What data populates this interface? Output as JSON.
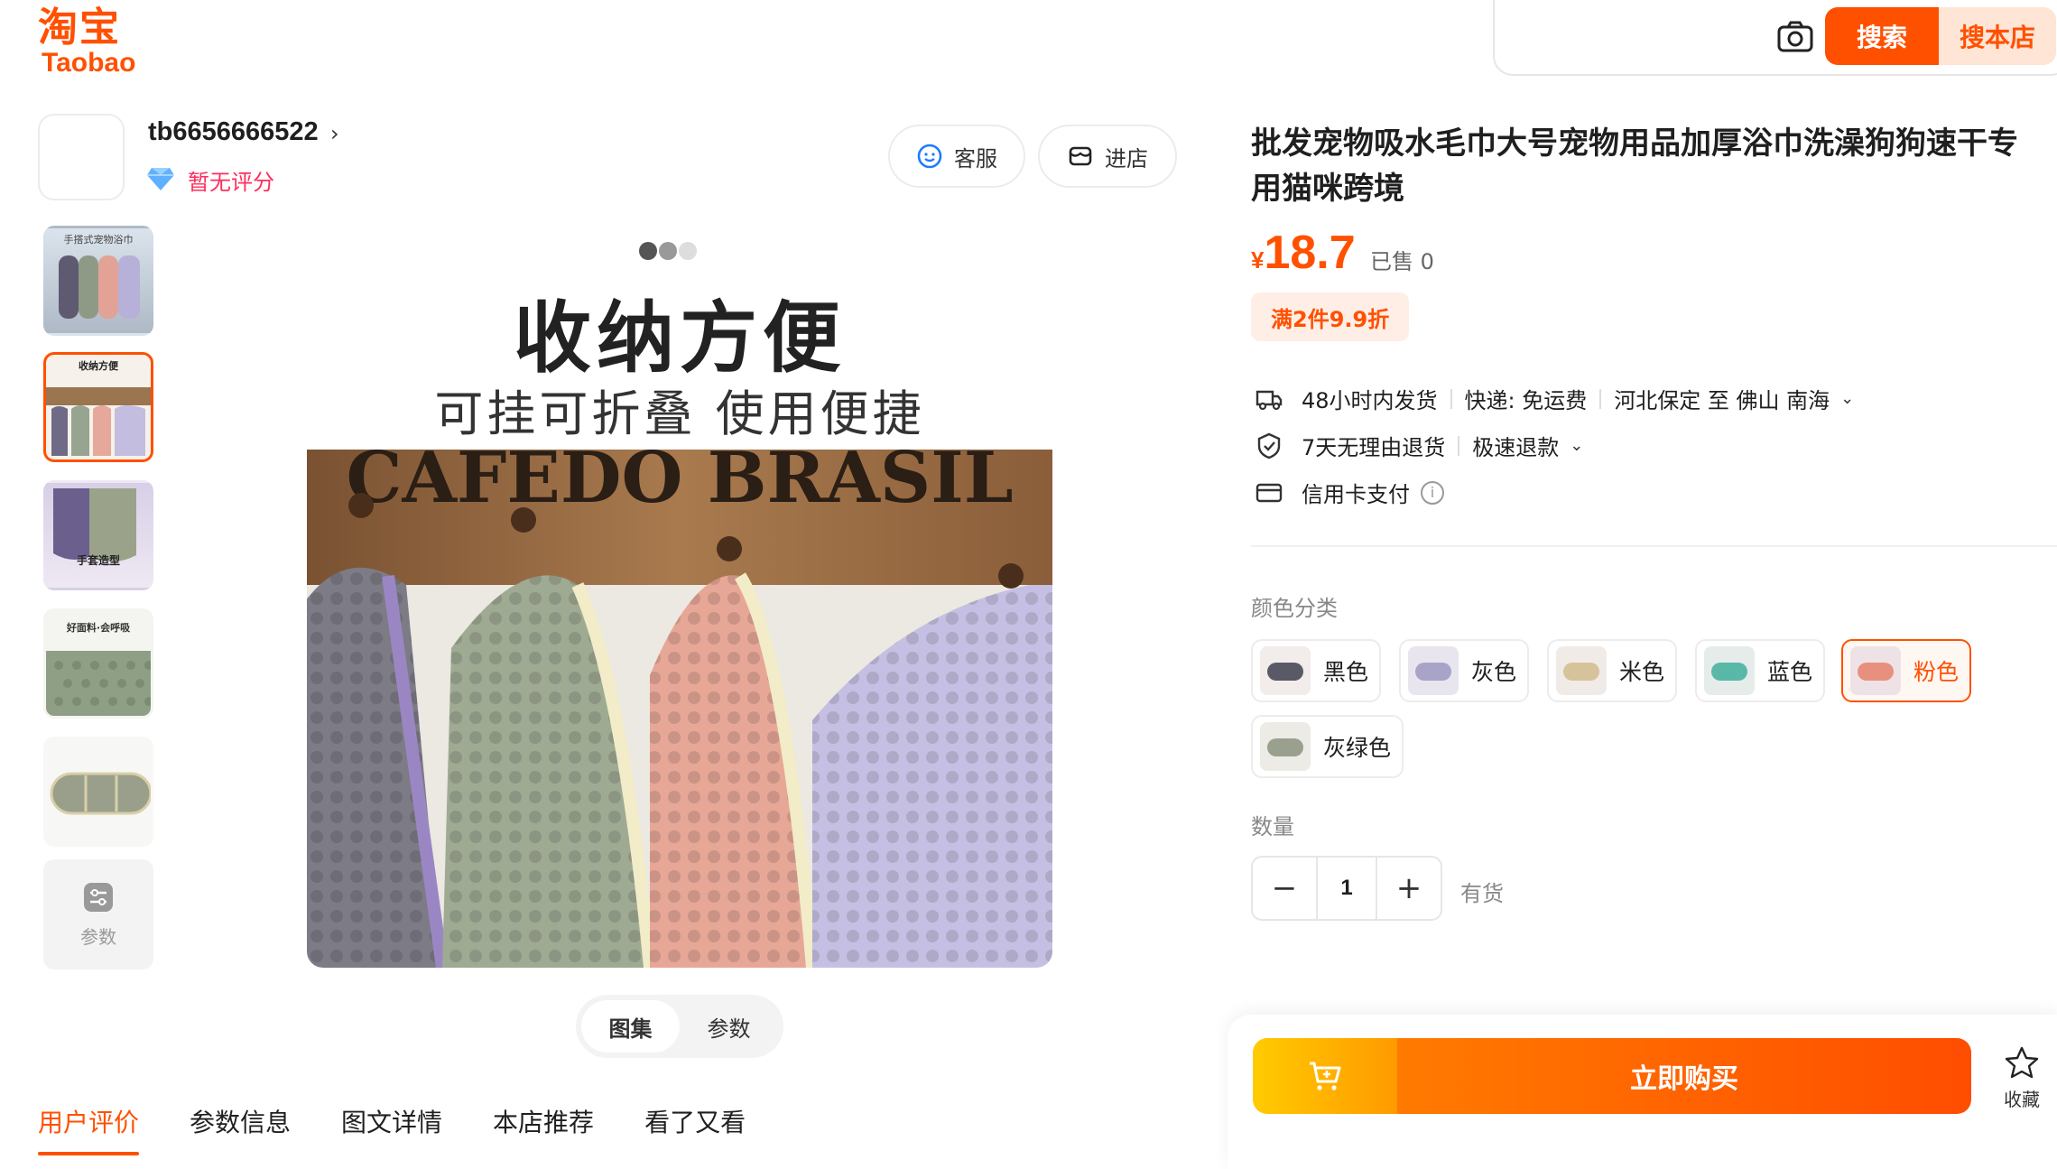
{
  "header": {
    "logo_cn": "淘宝",
    "logo_en": "Taobao",
    "search_placeholder": "",
    "search_button": "搜索",
    "shop_search_button": "搜本店"
  },
  "shop": {
    "name": "tb6656666522",
    "rating": "暂无评分",
    "service_button": "客服",
    "enter_shop_button": "进店"
  },
  "gallery": {
    "thumbnails": [
      {
        "caption": "手搭式宠物浴巾",
        "caption2": ""
      },
      {
        "caption": "收纳方便",
        "caption2": "CAFEDO BRASIL"
      },
      {
        "caption": "",
        "caption2": "手套造型"
      },
      {
        "caption": "好面料·会呼吸",
        "caption2": ""
      },
      {
        "caption": "",
        "caption2": ""
      }
    ],
    "params_thumb_label": "参数",
    "main_title": "收纳方便",
    "main_subtitle": "可挂可折叠 使用便捷",
    "sign_text": "CAFEDO BRASIL",
    "toggle": [
      "图集",
      "参数"
    ]
  },
  "tabs": [
    "用户评价",
    "参数信息",
    "图文详情",
    "本店推荐",
    "看了又看"
  ],
  "product": {
    "title": "批发宠物吸水毛巾大号宠物用品加厚浴巾洗澡狗狗速干专用猫咪跨境",
    "currency": "¥",
    "price": "18.7",
    "sold": "已售 0",
    "promo": "满2件9.9折",
    "shipping_time": "48小时内发货",
    "shipping_fee": "快递: 免运费",
    "route": "河北保定 至 佛山 南海",
    "returns": "7天无理由退货",
    "refund": "极速退款",
    "payment": "信用卡支付"
  },
  "sku": {
    "label": "颜色分类",
    "options": [
      {
        "label": "黑色",
        "color": "#5a5a66"
      },
      {
        "label": "灰色",
        "color": "#a8a4c8"
      },
      {
        "label": "米色",
        "color": "#d6c39a"
      },
      {
        "label": "蓝色",
        "color": "#5ab8a8"
      },
      {
        "label": "粉色",
        "color": "#e8907e"
      },
      {
        "label": "灰绿色",
        "color": "#9aa08e"
      }
    ],
    "selected": "粉色"
  },
  "quantity": {
    "label": "数量",
    "value": "1",
    "stock": "有货"
  },
  "actions": {
    "buy_now": "立即购买",
    "favorite": "收藏"
  },
  "colors": {
    "accent": "#ff5000",
    "price": "#ff5000",
    "rating": "#ff2d5c"
  }
}
